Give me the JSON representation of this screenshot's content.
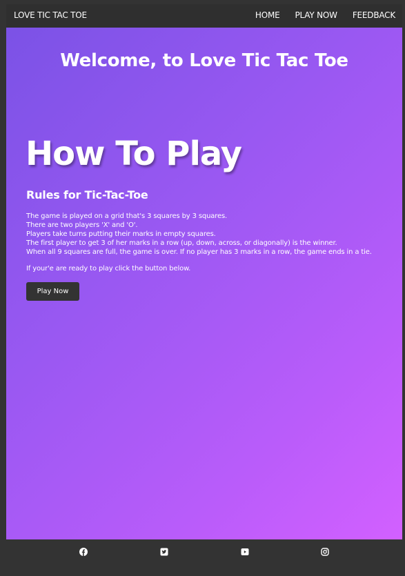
{
  "navbar": {
    "brand": "LOVE TIC TAC TOE",
    "links": [
      "HOME",
      "PLAY NOW",
      "FEEDBACK"
    ]
  },
  "hero": {
    "welcome": "Welcome, to Love Tic Tac Toe",
    "heading": "How To Play",
    "subheading": "Rules for Tic-Tac-Toe",
    "rules": [
      "The game is played on a grid that's 3 squares by 3 squares.",
      "There are two players 'X' and 'O'.",
      "Players take turns putting their marks in empty squares.",
      "The first player to get 3 of her marks in a row (up, down, across, or diagonally) is the winner.",
      "When all 9 squares are full, the game is over. If no player has 3 marks in a row, the game ends in a tie."
    ],
    "ready_text": "If your'e are ready to play click the button below.",
    "button_label": "Play Now"
  },
  "footer": {
    "icons": [
      "facebook-icon",
      "twitter-icon",
      "youtube-icon",
      "instagram-icon"
    ]
  },
  "colors": {
    "nav_bg": "#2f2f2f",
    "gradient_start": "#7b52e6",
    "gradient_end": "#d260ff",
    "button_bg": "#333333"
  }
}
